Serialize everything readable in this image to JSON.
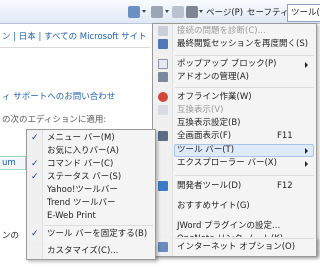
{
  "toolbar": {
    "page_label": "ページ(P)",
    "safety_label": "セーフティ(S)",
    "tools_label": "ツール(O)",
    "help_label": "?"
  },
  "page": {
    "nav_text": "ン | 日本 | すべての Microsoft サイト",
    "support_text": "ィ  サポートへのお問い合わせ",
    "edition_text": "の次のエディションに適用:",
    "um_text": "um",
    "bottom_text": "ンの"
  },
  "tools_menu": {
    "items": [
      {
        "label": "接続の問題を診断(C)...",
        "disabled": true
      },
      {
        "label": "最終閲覧セッションを再度開く(S)"
      },
      {
        "label": "ポップアップ ブロック(P)",
        "submenu": true
      },
      {
        "label": "アドオンの管理(A)"
      },
      {
        "label": "オフライン作業(W)"
      },
      {
        "label": "互換表示(V)",
        "disabled": true
      },
      {
        "label": "互換表示設定(B)"
      },
      {
        "label": "全画面表示(F)",
        "shortcut": "F11"
      },
      {
        "label": "ツール バー(T)",
        "submenu": true,
        "highlighted": true
      },
      {
        "label": "エクスプローラー バー(X)",
        "submenu": true
      },
      {
        "label": "開発者ツール(D)",
        "shortcut": "F12"
      },
      {
        "label": "おすすめサイト(G)"
      },
      {
        "label": "JWord プラグインの設定..."
      },
      {
        "label": "OneNote リンク ノート(K)"
      },
      {
        "label": "OneNote に送る(N)"
      },
      {
        "label": "インターネット オプション(O)"
      }
    ]
  },
  "toolbars_submenu": {
    "items": [
      {
        "label": "メニュー バー(M)",
        "checked": true
      },
      {
        "label": "お気に入りバー(A)",
        "checked": false
      },
      {
        "label": "コマンド バー(C)",
        "checked": true
      },
      {
        "label": "ステータス バー(S)",
        "checked": true
      },
      {
        "label": "Yahoo!ツールバー",
        "checked": false
      },
      {
        "label": "Trend ツールバー",
        "checked": false
      },
      {
        "label": "E-Web Print",
        "checked": false
      },
      {
        "label": "ツール バーを固定する(B)",
        "checked": true
      },
      {
        "label": "カスタマイズ(C)...",
        "checked": false
      }
    ],
    "check_mark": "✓"
  },
  "colors": {
    "highlight_bg": "#dfeaf8",
    "highlight_border": "#a8c3e6",
    "link": "#1b5fb0",
    "disabled": "#9a9a9a"
  }
}
